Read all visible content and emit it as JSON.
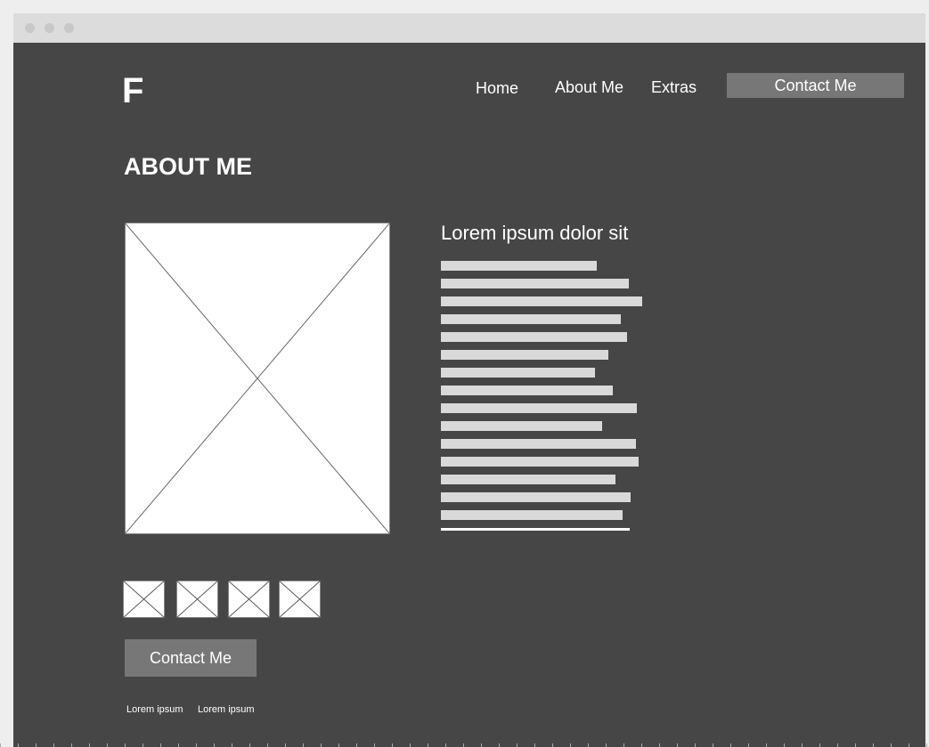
{
  "header": {
    "logo": "F",
    "nav": {
      "home": "Home",
      "about": "About Me",
      "extras": "Extras",
      "contact": "Contact Me"
    }
  },
  "main": {
    "page_title": "ABOUT ME",
    "subtitle": "Lorem ipsum dolor sit",
    "contact_button": "Contact Me"
  },
  "footer": {
    "links": [
      "Lorem ipsum",
      "Lorem ipsum"
    ]
  },
  "icons": {
    "image_placeholder": "image-placeholder-icon",
    "thumbnail": "image-thumbnail-icon"
  },
  "colors": {
    "background": "#464646",
    "button": "#777777",
    "text": "#ffffff",
    "text_line": "#d9d9d9"
  }
}
